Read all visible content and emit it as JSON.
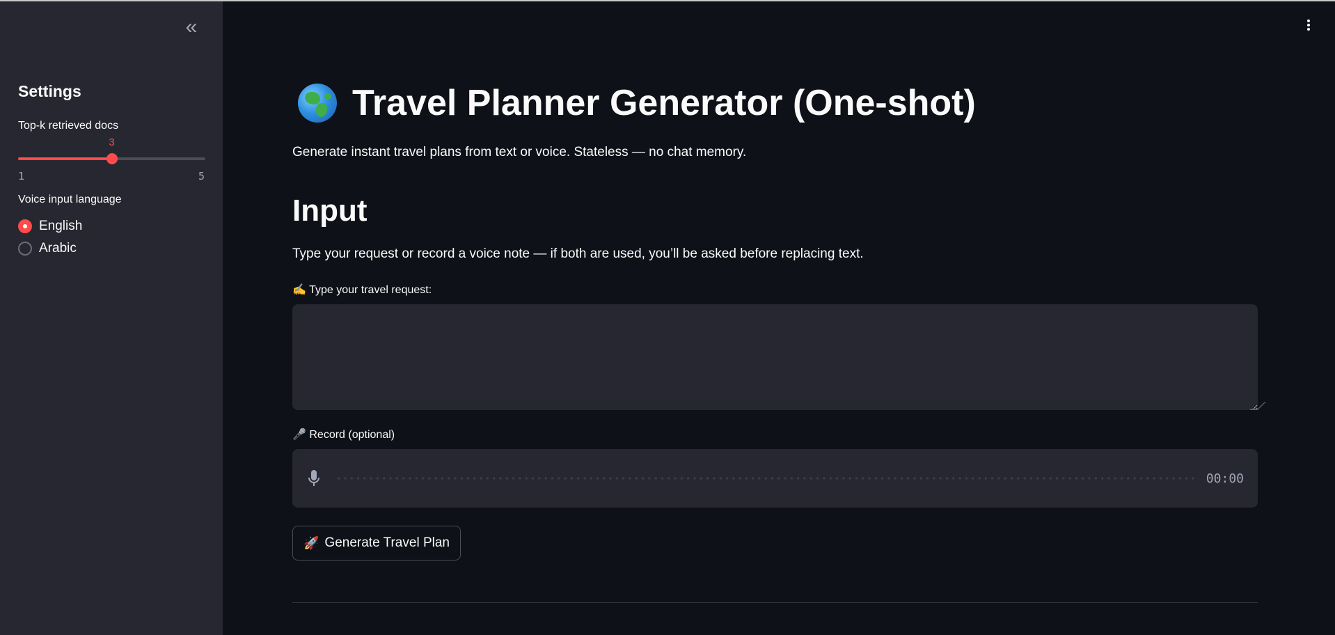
{
  "sidebar": {
    "collapse_glyph": "«",
    "title": "Settings",
    "slider": {
      "label": "Top-k retrieved docs",
      "min_label": "1",
      "max_label": "5",
      "min": 1,
      "max": 5,
      "value": 3,
      "value_label": "3",
      "accent_color": "#ff4b4b"
    },
    "voice_language": {
      "label": "Voice input language",
      "options": [
        {
          "label": "English",
          "selected": true
        },
        {
          "label": "Arabic",
          "selected": false
        }
      ]
    }
  },
  "main": {
    "title_icon": "globe-icon",
    "title": "Travel Planner Generator (One-shot)",
    "subtitle": "Generate instant travel plans from text or voice. Stateless — no chat memory.",
    "input_section": {
      "heading": "Input",
      "description": "Type your request or record a voice note — if both are used, you’ll be asked before replacing text.",
      "text_label": "✍️ Type your travel request:",
      "text_value": "",
      "record_label": "🎤 Record (optional)",
      "record_timer": "00:00"
    },
    "generate_button": {
      "icon": "🚀",
      "label": "Generate Travel Plan"
    }
  },
  "colors": {
    "background": "#0e1117",
    "sidebar": "#262730",
    "accent": "#ff4b4b"
  }
}
